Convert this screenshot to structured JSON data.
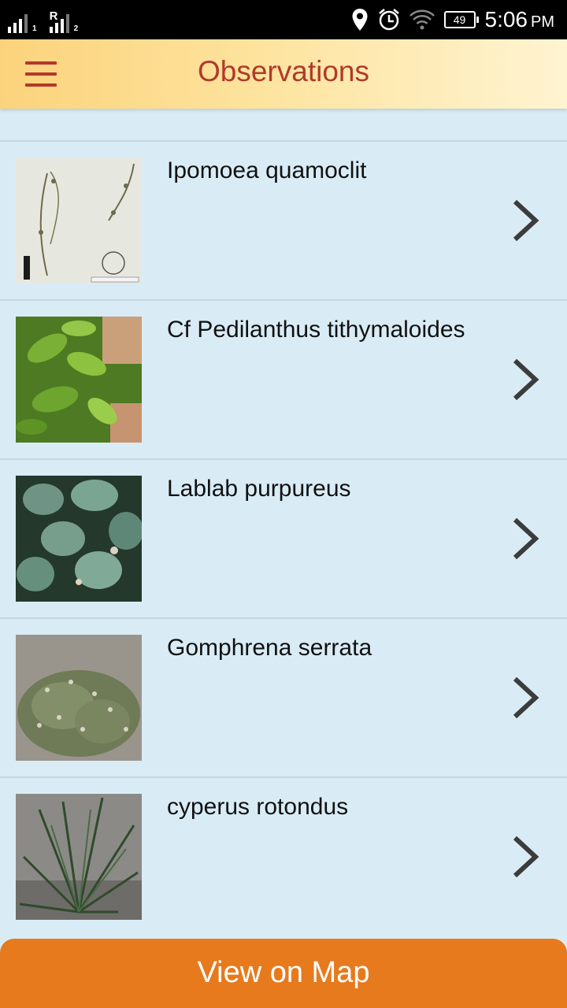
{
  "status_bar": {
    "sim1_label": "1",
    "sim2_roaming": "R",
    "sim2_label": "2",
    "battery": "49",
    "time": "5:06",
    "ampm": "PM",
    "icons": [
      "location-icon",
      "alarm-icon",
      "wifi-icon"
    ]
  },
  "header": {
    "title": "Observations",
    "menu_icon": "hamburger-menu-icon",
    "accent_color": "#b03a2a"
  },
  "observations": [
    {
      "name": "Ipomoea quamoclit",
      "thumb": "herbarium-sheet"
    },
    {
      "name": "Cf Pedilanthus tithymaloides",
      "thumb": "green-leaves"
    },
    {
      "name": "Lablab purpureus",
      "thumb": "vine-leaves"
    },
    {
      "name": "Gomphrena serrata",
      "thumb": "grassy-plant"
    },
    {
      "name": "cyperus rotondus",
      "thumb": "sedge"
    }
  ],
  "footer": {
    "map_button_label": "View on Map",
    "button_color": "#e67a1d"
  }
}
